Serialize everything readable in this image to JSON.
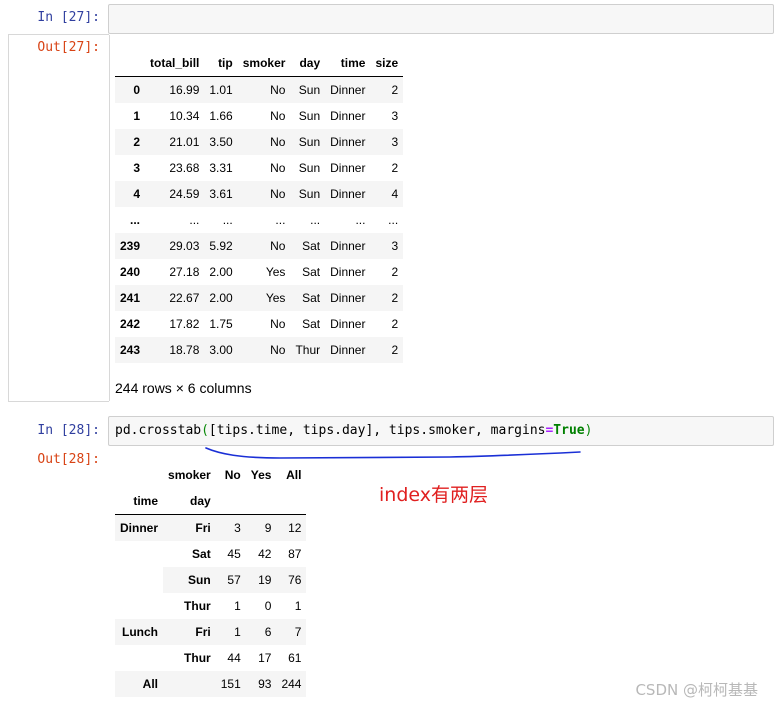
{
  "cell27": {
    "in_prompt": "In [27]:",
    "code": "tips",
    "out_prompt": "Out[27]:",
    "columns": [
      "",
      "total_bill",
      "tip",
      "smoker",
      "day",
      "time",
      "size"
    ],
    "rows": [
      [
        "0",
        "16.99",
        "1.01",
        "No",
        "Sun",
        "Dinner",
        "2"
      ],
      [
        "1",
        "10.34",
        "1.66",
        "No",
        "Sun",
        "Dinner",
        "3"
      ],
      [
        "2",
        "21.01",
        "3.50",
        "No",
        "Sun",
        "Dinner",
        "3"
      ],
      [
        "3",
        "23.68",
        "3.31",
        "No",
        "Sun",
        "Dinner",
        "2"
      ],
      [
        "4",
        "24.59",
        "3.61",
        "No",
        "Sun",
        "Dinner",
        "4"
      ],
      [
        "...",
        "...",
        "...",
        "...",
        "...",
        "...",
        "..."
      ],
      [
        "239",
        "29.03",
        "5.92",
        "No",
        "Sat",
        "Dinner",
        "3"
      ],
      [
        "240",
        "27.18",
        "2.00",
        "Yes",
        "Sat",
        "Dinner",
        "2"
      ],
      [
        "241",
        "22.67",
        "2.00",
        "Yes",
        "Sat",
        "Dinner",
        "2"
      ],
      [
        "242",
        "17.82",
        "1.75",
        "No",
        "Sat",
        "Dinner",
        "2"
      ],
      [
        "243",
        "18.78",
        "3.00",
        "No",
        "Thur",
        "Dinner",
        "2"
      ]
    ],
    "shape": "244 rows × 6 columns"
  },
  "cell28": {
    "in_prompt": "In [28]:",
    "code_tokens": {
      "func": "pd.crosstab",
      "open_paren": "(",
      "args1": "[tips.time, tips.day], tips.smoker, margins",
      "eq": "=",
      "true_kw": "True",
      "close_paren": ")"
    },
    "out_prompt": "Out[28]:",
    "col_axis_name": "smoker",
    "columns": [
      "No",
      "Yes",
      "All"
    ],
    "index_names": [
      "time",
      "day"
    ],
    "rows": [
      {
        "time": "Dinner",
        "day": "Fri",
        "values": [
          "3",
          "9",
          "12"
        ]
      },
      {
        "time": "",
        "day": "Sat",
        "values": [
          "45",
          "42",
          "87"
        ]
      },
      {
        "time": "",
        "day": "Sun",
        "values": [
          "57",
          "19",
          "76"
        ]
      },
      {
        "time": "",
        "day": "Thur",
        "values": [
          "1",
          "0",
          "1"
        ]
      },
      {
        "time": "Lunch",
        "day": "Fri",
        "values": [
          "1",
          "6",
          "7"
        ]
      },
      {
        "time": "",
        "day": "Thur",
        "values": [
          "44",
          "17",
          "61"
        ]
      },
      {
        "time": "All",
        "day": "",
        "values": [
          "151",
          "93",
          "244"
        ]
      }
    ]
  },
  "annotation": "index有两层",
  "watermark": "CSDN @柯柯基基",
  "colors": {
    "in_prompt": "#303f9f",
    "out_prompt": "#d84315",
    "annotation": "#e02020",
    "underline": "#1a2fd6"
  }
}
